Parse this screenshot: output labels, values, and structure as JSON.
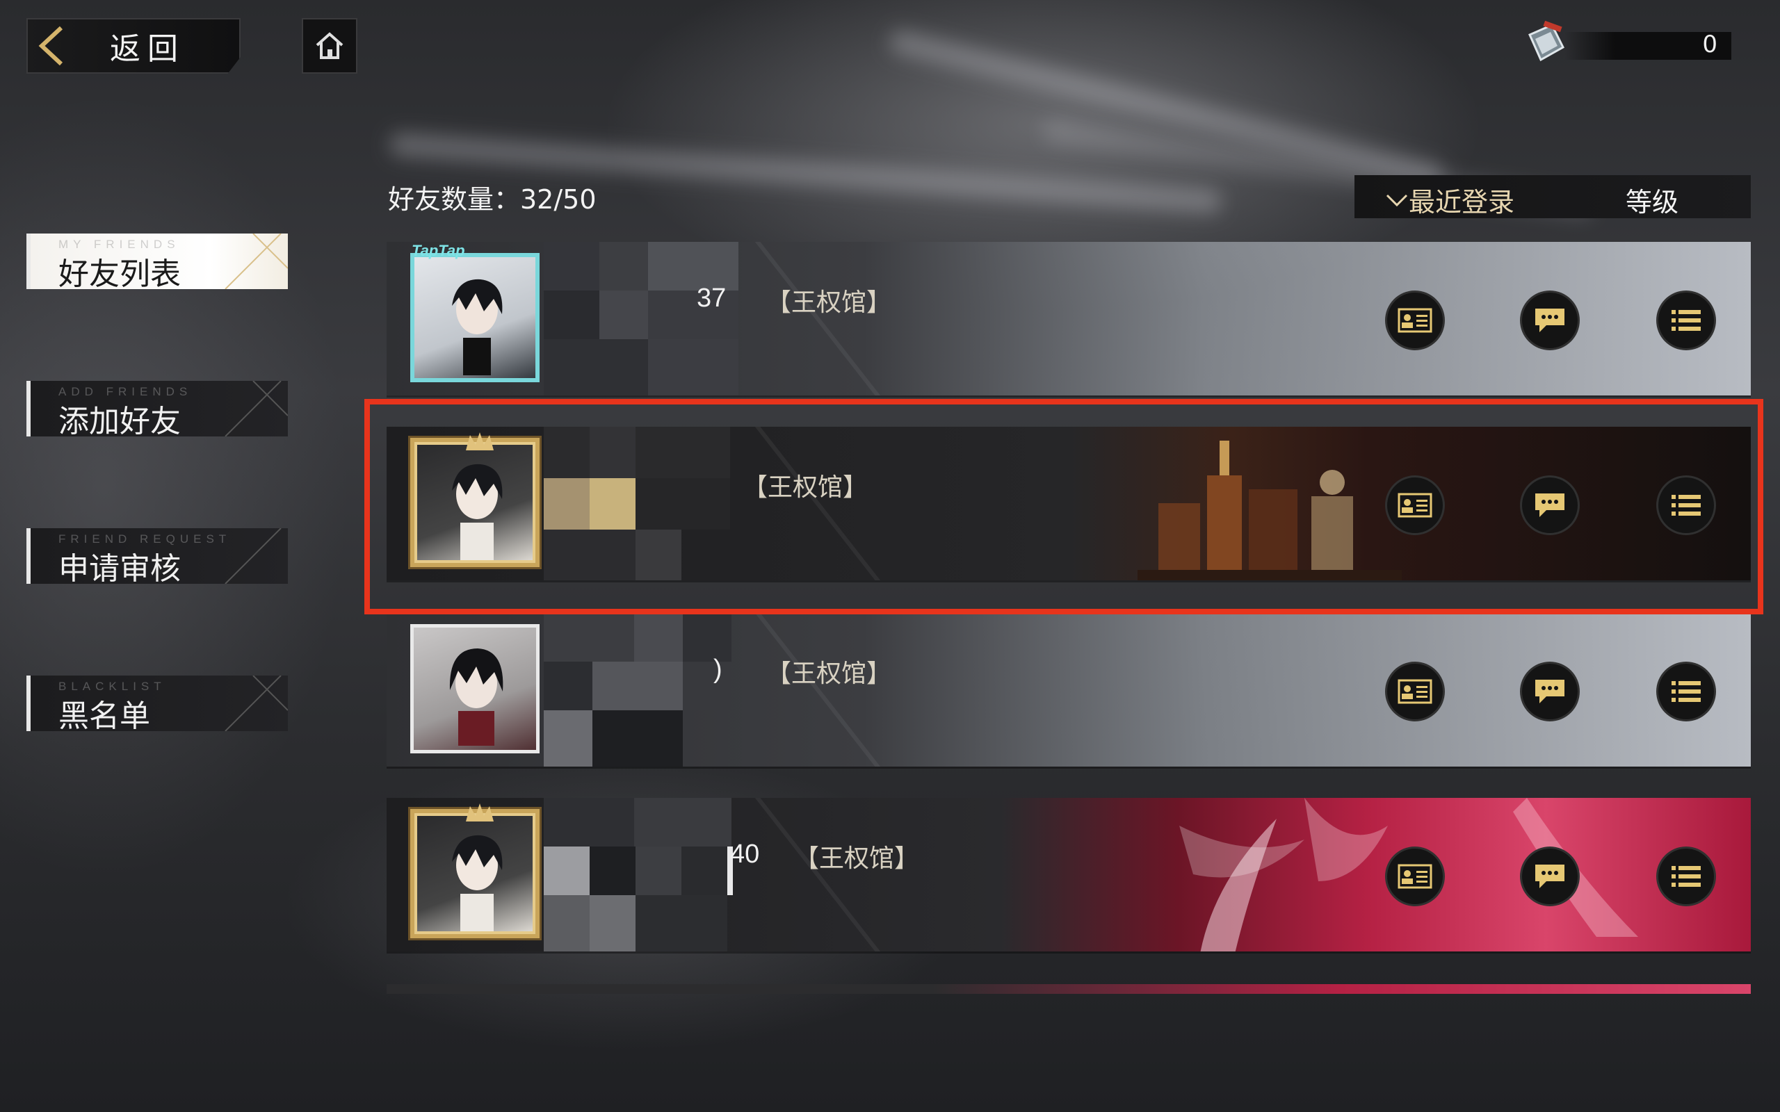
{
  "topbar": {
    "back_label": "返回",
    "currency_value": "0"
  },
  "menu": [
    {
      "sub": "MY FRIENDS",
      "label": "好友列表",
      "active": true
    },
    {
      "sub": "ADD FRIENDS",
      "label": "添加好友",
      "active": false
    },
    {
      "sub": "FRIEND REQUEST",
      "label": "申请审核",
      "active": false
    },
    {
      "sub": "BLACKLIST",
      "label": "黑名单",
      "active": false
    }
  ],
  "friends_count": "好友数量：32/50",
  "sort": {
    "recent_label": "最近登录",
    "level_label": "等级"
  },
  "friends": [
    {
      "name_fragment": "37",
      "guild": "【王权馆】",
      "frame": "taptap",
      "frame_tag": "TapTap",
      "banner": "silver"
    },
    {
      "name_fragment": "",
      "guild": "【王权馆】",
      "frame": "gold",
      "banner": "gold"
    },
    {
      "name_fragment": ")",
      "guild": "【王权馆】",
      "frame": "white",
      "banner": "silver"
    },
    {
      "name_fragment": "40",
      "guild": "【王权馆】",
      "frame": "gold",
      "banner": "crimson"
    }
  ],
  "colors": {
    "highlight": "#e8341c",
    "gold_accent": "#c9a55a",
    "icon_gold": "#e6c874"
  },
  "icons": [
    "back-chevron-icon",
    "home-icon",
    "gem-currency-icon",
    "profile-card-icon",
    "chat-bubble-icon",
    "list-menu-icon"
  ]
}
